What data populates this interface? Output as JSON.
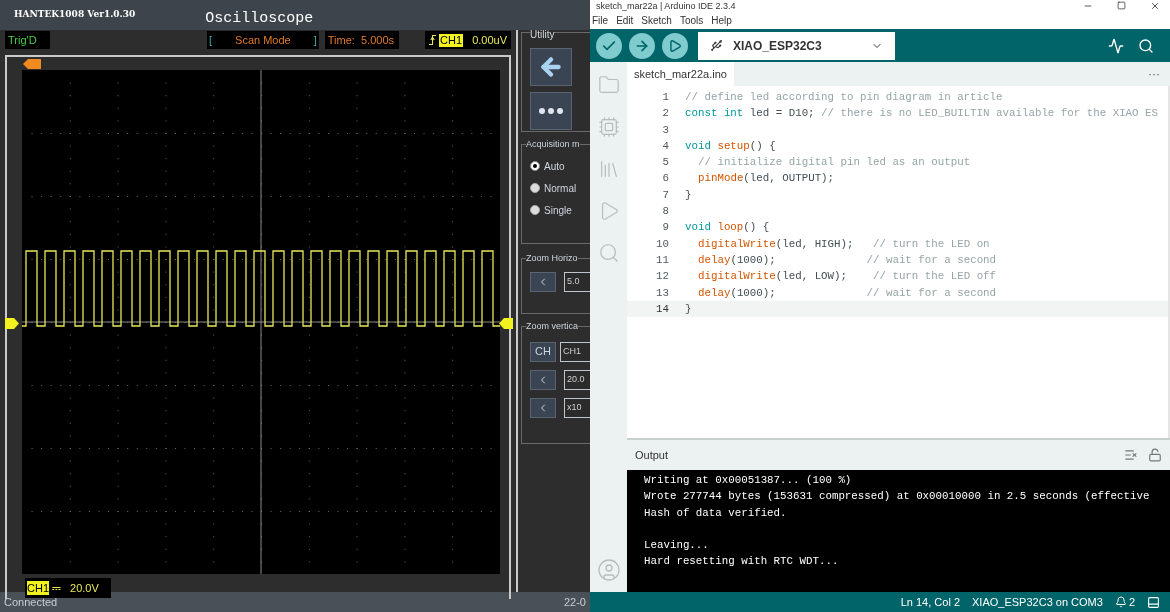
{
  "scope": {
    "app_version": "HANTEK1008 Ver1.0.30",
    "title": "Oscilloscope",
    "trig_status": "Trig'D",
    "bracket_left": "[",
    "mode": "Scan Mode",
    "bracket_right": "]",
    "time": "Time:  5.000s",
    "trigger_channel": "CH1",
    "trigger_level": "0.00uV",
    "footer_channel": "CH1",
    "footer_coupling": "⎓",
    "footer_scale": "20.0V",
    "status": "Connected",
    "status_right": "22-0"
  },
  "controls": {
    "utility_label": "Utility",
    "acquisition_label": "Acquisition m",
    "modes": [
      {
        "label": "Auto",
        "selected": true
      },
      {
        "label": "Normal",
        "selected": false
      },
      {
        "label": "Single",
        "selected": false
      }
    ],
    "zoom_h_label": "Zoom Horizo",
    "zoom_h_value": "5.0",
    "zoom_v_label": "Zoom vertica",
    "channel_button": "CH",
    "channel_value": "CH1",
    "volt_value": "20.0",
    "probe_value": "x10"
  },
  "ide": {
    "title": "sketch_mar22a | Arduino IDE 2.3.4",
    "menu": [
      "File",
      "Edit",
      "Sketch",
      "Tools",
      "Help"
    ],
    "board": "XIAO_ESP32C3",
    "tab": "sketch_mar22a.ino",
    "more": "···",
    "code": [
      {
        "num": "1",
        "current": false,
        "parts": [
          {
            "kind": "comment",
            "text": "// define led according to pin diagram in article"
          }
        ]
      },
      {
        "num": "2",
        "current": false,
        "parts": [
          {
            "kind": "keyword",
            "text": "const int"
          },
          {
            "kind": "plain",
            "text": " led = D10; "
          },
          {
            "kind": "comment",
            "text": "// there is no LED_BUILTIN available for the XIAO ES"
          }
        ]
      },
      {
        "num": "3",
        "current": false
      },
      {
        "num": "4",
        "current": false,
        "parts": [
          {
            "kind": "keyword",
            "text": "void "
          },
          {
            "kind": "function",
            "text": "setup"
          },
          {
            "kind": "plain",
            "text": "() {"
          }
        ]
      },
      {
        "num": "5",
        "current": false,
        "indent": true,
        "parts": [
          {
            "kind": "comment",
            "text": "// initialize digital pin led as an output"
          }
        ]
      },
      {
        "num": "6",
        "current": false,
        "indent": true,
        "parts": [
          {
            "kind": "function",
            "text": "pinMode"
          },
          {
            "kind": "plain",
            "text": "(led, OUTPUT);"
          }
        ]
      },
      {
        "num": "7",
        "current": false,
        "parts": [
          {
            "kind": "plain",
            "text": "}"
          }
        ]
      },
      {
        "num": "8",
        "current": false
      },
      {
        "num": "9",
        "current": false,
        "parts": [
          {
            "kind": "keyword",
            "text": "void "
          },
          {
            "kind": "function",
            "text": "loop"
          },
          {
            "kind": "plain",
            "text": "() {"
          }
        ]
      },
      {
        "num": "10",
        "current": false,
        "indent": true,
        "parts": [
          {
            "kind": "function",
            "text": "digitalWrite"
          },
          {
            "kind": "plain",
            "text": "(led, HIGH);   "
          },
          {
            "kind": "comment",
            "text": "// turn the LED on"
          }
        ]
      },
      {
        "num": "11",
        "current": false,
        "indent": true,
        "parts": [
          {
            "kind": "function",
            "text": "delay"
          },
          {
            "kind": "plain",
            "text": "(1000);              "
          },
          {
            "kind": "comment",
            "text": "// wait for a second"
          }
        ]
      },
      {
        "num": "12",
        "current": false,
        "indent": true,
        "parts": [
          {
            "kind": "function",
            "text": "digitalWrite"
          },
          {
            "kind": "plain",
            "text": "(led, LOW);    "
          },
          {
            "kind": "comment",
            "text": "// turn the LED off"
          }
        ]
      },
      {
        "num": "13",
        "current": false,
        "indent": true,
        "parts": [
          {
            "kind": "function",
            "text": "delay"
          },
          {
            "kind": "plain",
            "text": "(1000);              "
          },
          {
            "kind": "comment",
            "text": "// wait for a second"
          }
        ]
      },
      {
        "num": "14",
        "current": true,
        "parts": [
          {
            "kind": "plain",
            "text": "}"
          }
        ]
      }
    ],
    "output_label": "Output",
    "output_lines": [
      {
        "text": "Writing at 0x00051387... (100 %)",
        "gap_before": false
      },
      {
        "text": "Wrote 277744 bytes (153631 compressed) at 0x00010000 in 2.5 seconds (effective",
        "gap_before": false
      },
      {
        "text": "Hash of data verified.",
        "gap_before": false
      },
      {
        "text": "Leaving...",
        "gap_before": true
      },
      {
        "text": "Hard resetting with RTC WDT...",
        "gap_before": false
      }
    ],
    "status_position": "Ln 14, Col 2",
    "status_board": "XIAO_ESP32C3 on COM3",
    "notifications": "2"
  }
}
